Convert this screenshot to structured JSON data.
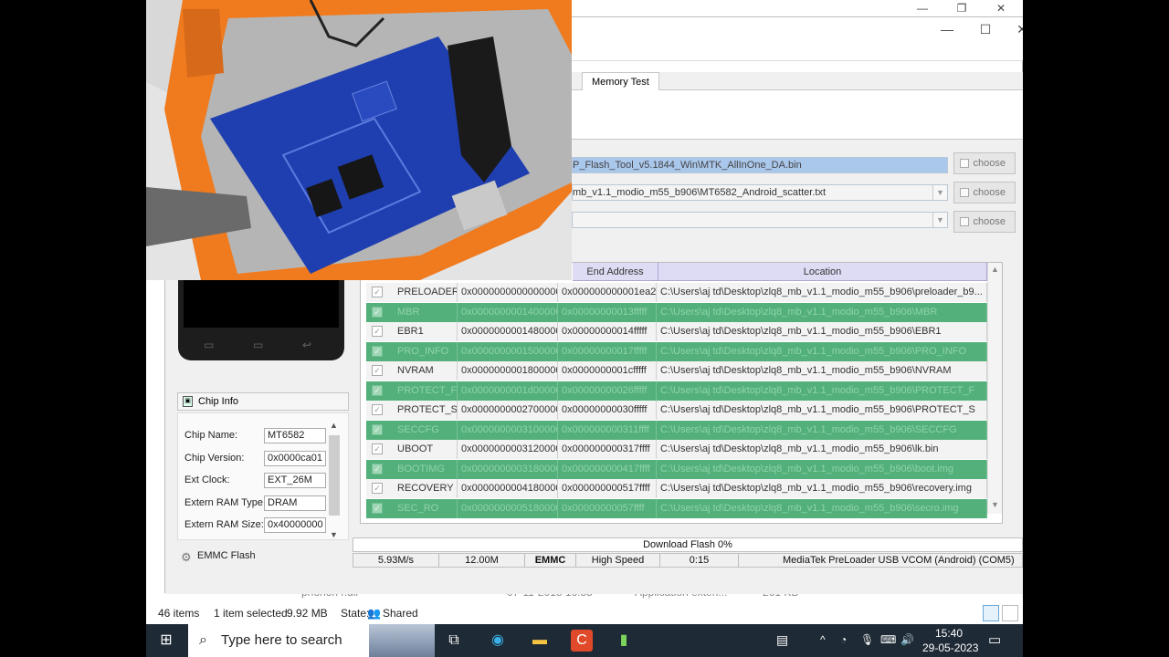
{
  "explorer": {
    "status": {
      "items": "46 items",
      "selected": "1 item selected",
      "size": "9.92 MB",
      "state_label": "State:",
      "state_value": "Shared"
    },
    "partial_row": {
      "name": "phonon4.dll",
      "date": "07-11-2018 16:55",
      "type": "Application exten...",
      "size": "261 KB"
    }
  },
  "flash_tool": {
    "tabs": [
      {
        "label": "Memory Test"
      }
    ],
    "paths": {
      "download_agent": "P_Flash_Tool_v5.1844_Win\\MTK_AllInOne_DA.bin",
      "scatter": "mb_v1.1_modio_m55_b906\\MT6582_Android_scatter.txt",
      "auth": ""
    },
    "choose_label": "choose",
    "table": {
      "headers": [
        "End Address",
        "Location"
      ],
      "rows": [
        {
          "name": "PRELOADER",
          "begin": "0x0000000000000000",
          "end": "0x000000000001ea27",
          "location": "C:\\Users\\aj td\\Desktop\\zlq8_mb_v1.1_modio_m55_b906\\preloader_b9..."
        },
        {
          "name": "MBR",
          "begin": "0x0000000001400000",
          "end": "0x00000000013fffff",
          "location": "C:\\Users\\aj td\\Desktop\\zlq8_mb_v1.1_modio_m55_b906\\MBR"
        },
        {
          "name": "EBR1",
          "begin": "0x0000000001480000",
          "end": "0x00000000014fffff",
          "location": "C:\\Users\\aj td\\Desktop\\zlq8_mb_v1.1_modio_m55_b906\\EBR1"
        },
        {
          "name": "PRO_INFO",
          "begin": "0x0000000001500000",
          "end": "0x00000000017fffff",
          "location": "C:\\Users\\aj td\\Desktop\\zlq8_mb_v1.1_modio_m55_b906\\PRO_INFO"
        },
        {
          "name": "NVRAM",
          "begin": "0x0000000001800000",
          "end": "0x0000000001cfffff",
          "location": "C:\\Users\\aj td\\Desktop\\zlq8_mb_v1.1_modio_m55_b906\\NVRAM"
        },
        {
          "name": "PROTECT_F",
          "begin": "0x0000000001d00000",
          "end": "0x00000000026fffff",
          "location": "C:\\Users\\aj td\\Desktop\\zlq8_mb_v1.1_modio_m55_b906\\PROTECT_F"
        },
        {
          "name": "PROTECT_S",
          "begin": "0x0000000002700000",
          "end": "0x00000000030fffff",
          "location": "C:\\Users\\aj td\\Desktop\\zlq8_mb_v1.1_modio_m55_b906\\PROTECT_S"
        },
        {
          "name": "SECCFG",
          "begin": "0x0000000003100000",
          "end": "0x000000000311ffff",
          "location": "C:\\Users\\aj td\\Desktop\\zlq8_mb_v1.1_modio_m55_b906\\SECCFG"
        },
        {
          "name": "UBOOT",
          "begin": "0x0000000003120000",
          "end": "0x000000000317ffff",
          "location": "C:\\Users\\aj td\\Desktop\\zlq8_mb_v1.1_modio_m55_b906\\lk.bin"
        },
        {
          "name": "BOOTIMG",
          "begin": "0x0000000003180000",
          "end": "0x000000000417ffff",
          "location": "C:\\Users\\aj td\\Desktop\\zlq8_mb_v1.1_modio_m55_b906\\boot.img"
        },
        {
          "name": "RECOVERY",
          "begin": "0x0000000004180000",
          "end": "0x000000000517ffff",
          "location": "C:\\Users\\aj td\\Desktop\\zlq8_mb_v1.1_modio_m55_b906\\recovery.img"
        },
        {
          "name": "SEC_RO",
          "begin": "0x0000000005180000",
          "end": "0x00000000057ffff",
          "location": "C:\\Users\\aj td\\Desktop\\zlq8_mb_v1.1_modio_m55_b906\\secro.img"
        }
      ]
    },
    "chip_info": {
      "title": "Chip Info",
      "fields": [
        {
          "label": "Chip Name:",
          "value": "MT6582"
        },
        {
          "label": "Chip Version:",
          "value": "0x0000ca01"
        },
        {
          "label": "Ext Clock:",
          "value": "EXT_26M"
        },
        {
          "label": "Extern RAM Type:",
          "value": "DRAM"
        },
        {
          "label": "Extern RAM Size:",
          "value": "0x40000000"
        }
      ]
    },
    "emmc_label": "EMMC Flash",
    "download_progress": {
      "label": "Download Flash 0%",
      "percent": 0
    },
    "status": {
      "speed": "5.93M/s",
      "size": "12.00M",
      "storage": "EMMC",
      "mode": "High Speed",
      "time": "0:15",
      "port": "MediaTek PreLoader USB VCOM (Android) (COM5)"
    }
  },
  "taskbar": {
    "search_placeholder": "Type here to search",
    "time": "15:40",
    "date": "29-05-2023"
  },
  "colors": {
    "row_green": "#53b07b",
    "header_purple": "#dedcf4",
    "path_highlight": "#aac7ec",
    "taskbar": "#1e2a35"
  }
}
